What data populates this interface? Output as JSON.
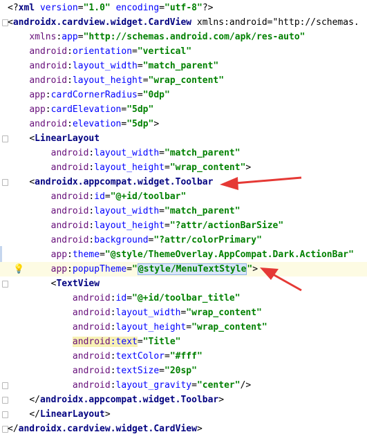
{
  "colors": {
    "tag": "#000080",
    "namespace": "#660e7a",
    "attribute": "#0000ff",
    "string": "#008000",
    "annotation_arrow": "#e53935",
    "current_line": "#fdfbe3"
  },
  "icons": [
    "lightbulb-icon",
    "fold-marker-icon"
  ],
  "lines": [
    [
      "<?xml version=\"1.0\" encoding=\"utf-8\"?>"
    ],
    [
      "<androidx.cardview.widget.CardView xmlns:android=\"http://schemas."
    ],
    [
      "    xmlns:app=\"http://schemas.android.com/apk/res-auto\""
    ],
    [
      "    android:orientation=\"vertical\""
    ],
    [
      "    android:layout_width=\"match_parent\""
    ],
    [
      "    android:layout_height=\"wrap_content\""
    ],
    [
      "    app:cardCornerRadius=\"0dp\""
    ],
    [
      "    app:cardElevation=\"5dp\""
    ],
    [
      "    android:elevation=\"5dp\">"
    ],
    [
      "    <LinearLayout"
    ],
    [
      "        android:layout_width=\"match_parent\""
    ],
    [
      "        android:layout_height=\"wrap_content\">"
    ],
    [
      "    <androidx.appcompat.widget.Toolbar"
    ],
    [
      "        android:id=\"@+id/toolbar\""
    ],
    [
      "        android:layout_width=\"match_parent\""
    ],
    [
      "        android:layout_height=\"?attr/actionBarSize\""
    ],
    [
      "        android:background=\"?attr/colorPrimary\""
    ],
    [
      "        app:theme=\"@style/ThemeOverlay.AppCompat.Dark.ActionBar\""
    ],
    [
      "        app:popupTheme=\"@style/MenuTextStyle\">"
    ],
    [
      "        <TextView"
    ],
    [
      "            android:id=\"@+id/toolbar_title\""
    ],
    [
      "            android:layout_width=\"wrap_content\""
    ],
    [
      "            android:layout_height=\"wrap_content\""
    ],
    [
      "            android:text=\"Title\""
    ],
    [
      "            android:textColor=\"#fff\""
    ],
    [
      "            android:textSize=\"20sp\""
    ],
    [
      "            android:layout_gravity=\"center\"/>"
    ],
    [
      "    </androidx.appcompat.widget.Toolbar>"
    ],
    [
      "    </LinearLayout>"
    ],
    [
      "</androidx.cardview.widget.CardView>"
    ]
  ]
}
